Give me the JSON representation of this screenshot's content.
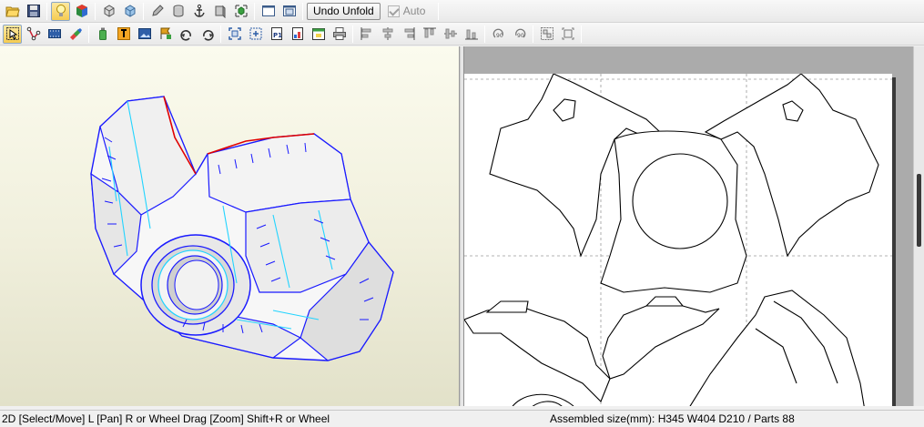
{
  "toolbar_top": {
    "icons": [
      "open-folder-icon",
      "save-icon",
      "lightbulb-icon",
      "color-cube-icon",
      "box-wireframe-icon",
      "box-shaded-icon",
      "pencil-icon",
      "cylinder-icon",
      "anchor-icon",
      "box-side-icon",
      "box-green-icon",
      "window-single-icon",
      "window-split-icon"
    ],
    "undo_unfold_label": "Undo Unfold",
    "auto_label": "Auto",
    "auto_checked": true
  },
  "toolbar_bottom": {
    "icons": [
      "select-move-icon",
      "edge-tool-icon",
      "film-icon",
      "paint-icon",
      "bottle-icon",
      "text-icon",
      "image-icon",
      "flag-icon",
      "rotate-left-icon",
      "rotate-right-icon",
      "fit-select-icon",
      "fit-all-icon",
      "page-number-icon",
      "page-icon",
      "calendar-icon",
      "printer-icon",
      "align-left-icon",
      "align-center-h-icon",
      "align-right-icon",
      "align-top-icon",
      "align-middle-v-icon",
      "align-bottom-icon",
      "rotate-90-ccw-icon",
      "rotate-90-cw-icon",
      "group-icon",
      "ungroup-icon"
    ],
    "select_active": true
  },
  "status": {
    "left_text": "2D [Select/Move] L [Pan] R or Wheel Drag [Zoom] Shift+R or Wheel",
    "right_text": "Assembled size(mm): H345 W404 D210 / Parts 88"
  },
  "colors": {
    "model_edge": "#1a1aff",
    "model_fold": "#22d4ff",
    "model_cut": "#e00000",
    "paper": "#ffffff"
  }
}
